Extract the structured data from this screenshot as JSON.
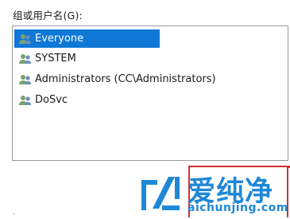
{
  "group_label": "组或用户名(G):",
  "users": [
    {
      "name": "Everyone",
      "icon": "users-group-icon",
      "selected": true
    },
    {
      "name": "SYSTEM",
      "icon": "users-group-icon",
      "selected": false
    },
    {
      "name": "Administrators (CC\\Administrators)",
      "icon": "users-group-icon",
      "selected": false
    },
    {
      "name": "DoSvc",
      "icon": "users-group-icon",
      "selected": false
    }
  ],
  "colors": {
    "selection": "#0f78d7",
    "watermark": "#1f88d6",
    "highlight_box": "#d32f2f"
  },
  "watermark": {
    "title": "爱纯净",
    "domain": "aichunjing.com"
  },
  "bottom_text": "·"
}
